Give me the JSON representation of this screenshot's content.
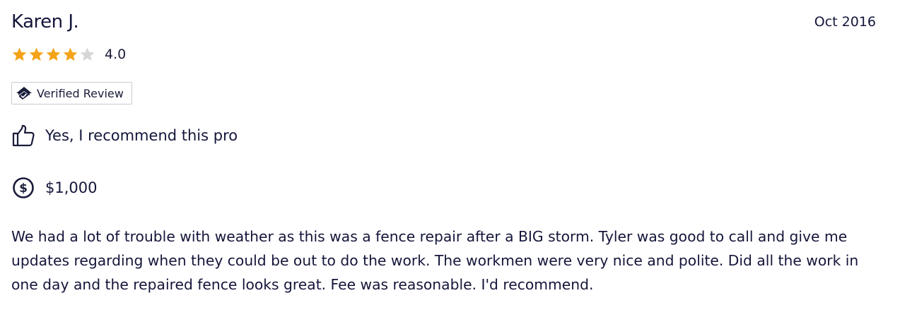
{
  "review": {
    "reviewer_name": "Karen J.",
    "date": "Oct 2016",
    "rating": {
      "value_label": "4.0",
      "stars_filled": 4,
      "stars_total": 5,
      "star_color": "#f4a31a",
      "empty_star_color": "#d6d6d6"
    },
    "verified_badge": {
      "label": "Verified Review",
      "icon": "verified-house-icon"
    },
    "recommendation": {
      "icon": "thumbs-up-icon",
      "text": "Yes, I recommend this pro"
    },
    "cost": {
      "icon": "dollar-circle-icon",
      "text": "$1,000"
    },
    "body": "We had a lot of trouble with weather as this was a fence repair after a BIG storm. Tyler was good to call and give me updates regarding when they could be out to do the work. The workmen were very nice and polite. Did all the work in one day and the repaired fence looks great. Fee was reasonable. I'd recommend."
  }
}
